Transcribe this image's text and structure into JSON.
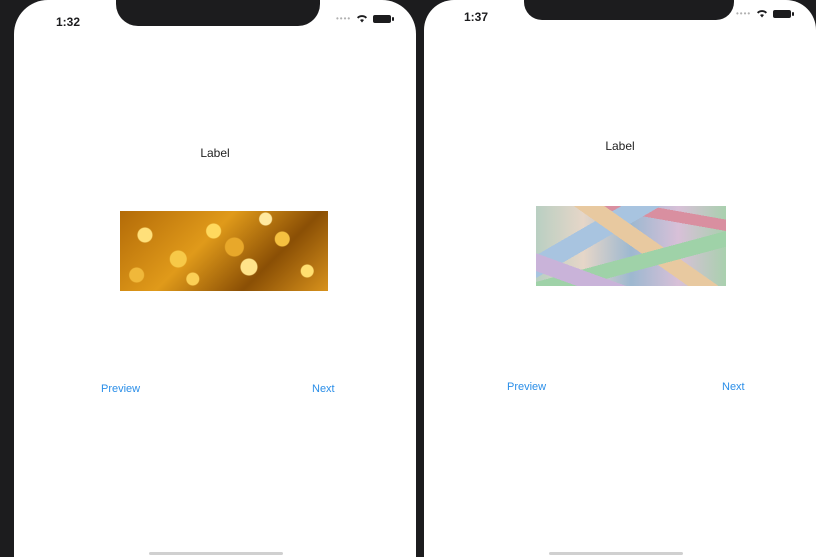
{
  "phones": [
    {
      "time": "1:32",
      "label": "Label",
      "image": "gold-coins-image",
      "preview_label": "Preview",
      "next_label": "Next"
    },
    {
      "time": "1:37",
      "label": "Label",
      "image": "euro-banknotes-image",
      "preview_label": "Preview",
      "next_label": "Next"
    }
  ],
  "colors": {
    "accent": "#2a8ee8",
    "frame": "#1c1c1e"
  },
  "icons": [
    "wifi-icon",
    "battery-icon"
  ]
}
